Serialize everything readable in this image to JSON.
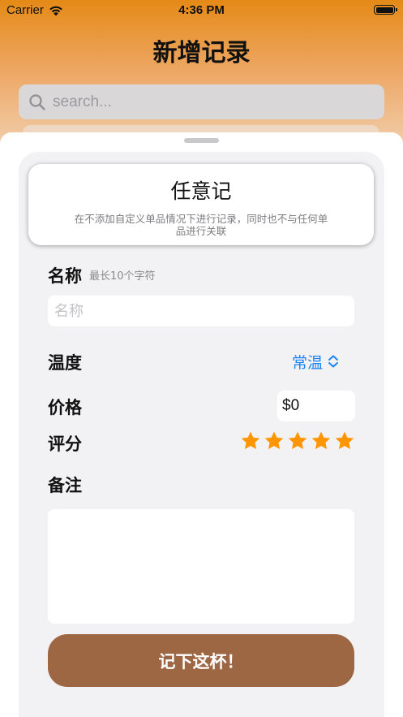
{
  "status_bar": {
    "carrier": "Carrier",
    "time": "4:36 PM"
  },
  "header": {
    "title": "新增记录"
  },
  "search": {
    "placeholder": "search..."
  },
  "mode_card": {
    "title": "任意记",
    "description": "在不添加自定义单品情况下进行记录，同时也不与任何单品进行关联"
  },
  "form": {
    "name_label": "名称",
    "name_hint": "最长10个字符",
    "name_placeholder": "名称",
    "name_value": "",
    "temperature_label": "温度",
    "temperature_value": "常温",
    "price_label": "价格",
    "price_value": "$0",
    "rating_label": "评分",
    "rating_value": 5,
    "rating_max": 5,
    "notes_label": "备注",
    "notes_value": "",
    "submit_label": "记下这杯！"
  },
  "colors": {
    "accent_blue": "#1a84f5",
    "star_orange": "#ff9500",
    "button_brown": "#9e6744",
    "header_orange": "#e58a17"
  }
}
